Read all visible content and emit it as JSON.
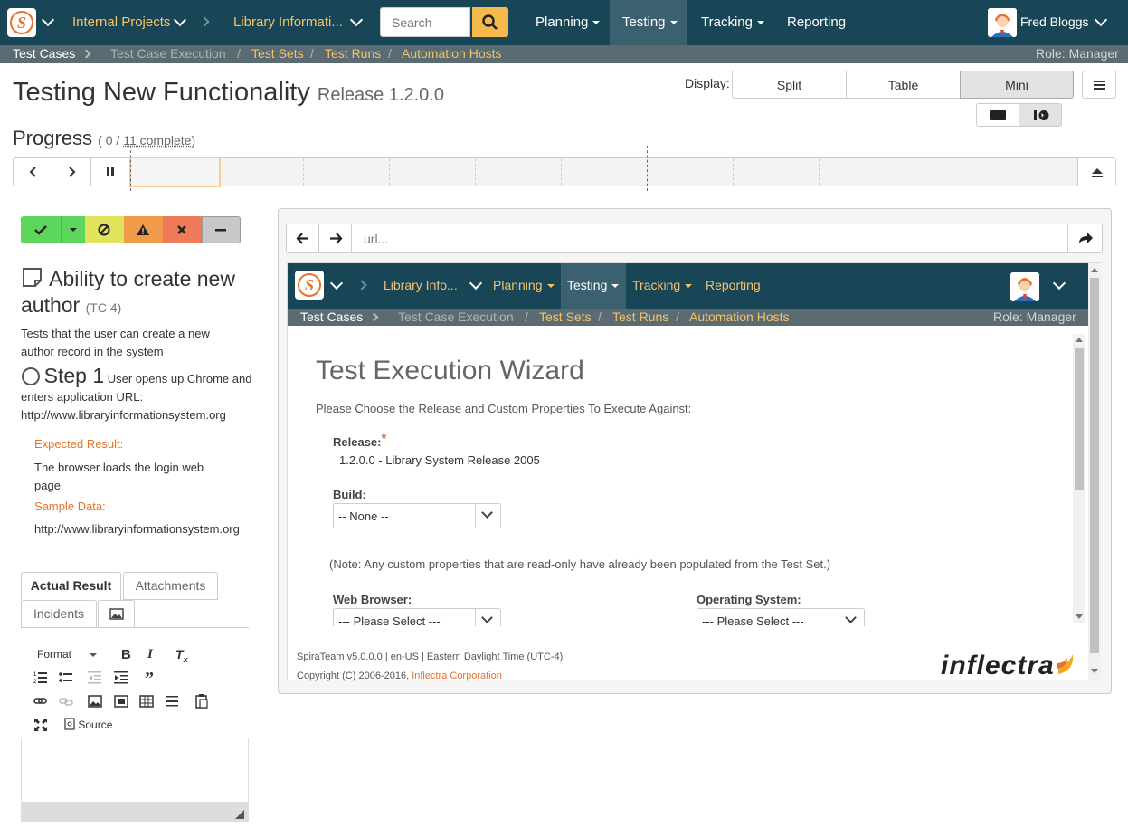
{
  "topnav": {
    "project": "Internal Projects",
    "product": "Library Informati...",
    "search_placeholder": "Search",
    "menu": {
      "planning": "Planning",
      "testing": "Testing",
      "tracking": "Tracking",
      "reporting": "Reporting"
    },
    "user": "Fred Bloggs"
  },
  "subnav": {
    "items": [
      "Test Cases",
      "Test Case Execution",
      "Test Sets",
      "Test Runs",
      "Automation Hosts"
    ],
    "separators": "/",
    "role": "Role: Manager"
  },
  "page": {
    "title": "Testing New Functionality",
    "release": "Release 1.2.0.0",
    "display_label": "Display:",
    "display_options": [
      "Split",
      "Table",
      "Mini"
    ],
    "display_selected": "Mini"
  },
  "progress": {
    "label": "Progress",
    "open_paren": "(",
    "done": "0",
    "slash": "/",
    "total_text": "11 complete",
    "close_paren": ")"
  },
  "testcase": {
    "title": "Ability to create new author",
    "id": "(TC 4)",
    "description": "Tests that the user can create a new author record in the system",
    "step_label": "Step 1",
    "step_desc": "User opens up Chrome and enters application URL: http://www.libraryinformationsystem.org",
    "expected_label": "Expected Result:",
    "expected": "The browser loads the login web page",
    "sample_label": "Sample Data:",
    "sample": "http://www.libraryinformationsystem.org"
  },
  "tabs": [
    "Actual Result",
    "Attachments",
    "Incidents"
  ],
  "editor": {
    "format": "Format",
    "source": "Source"
  },
  "browser": {
    "url_placeholder": "url...",
    "inner_nav": {
      "product": "Library Info...",
      "planning": "Planning",
      "testing": "Testing",
      "tracking": "Tracking",
      "reporting": "Reporting",
      "subitems": [
        "Test Cases",
        "Test Case Execution",
        "Test Sets",
        "Test Runs",
        "Automation Hosts"
      ],
      "role": "Role: Manager"
    },
    "wizard": {
      "title": "Test Execution Wizard",
      "intro": "Please Choose the Release and Custom Properties To Execute Against:",
      "release_label": "Release:",
      "required_mark": "*",
      "release_value": "1.2.0.0 - Library System Release 2005",
      "build_label": "Build:",
      "build_value": "-- None --",
      "note": "(Note: Any custom properties that are read-only have already been populated from the Test Set.)",
      "browser_label": "Web Browser:",
      "browser_value": "--- Please Select ---",
      "os_label": "Operating System:",
      "os_value": "--- Please Select ---"
    },
    "footer": {
      "line1": "SpiraTeam v5.0.0.0 | en-US | Eastern Daylight Time (UTC-4)",
      "line2": "Copyright (C) 2006-2016,",
      "company": "Inflectra Corporation",
      "logo_text": "inflectra"
    }
  },
  "colors": {
    "nav": "#184656",
    "accent": "#f5c26b",
    "orange": "#e8722c",
    "pass": "#5cd65c",
    "blocked": "#e2e35c",
    "caution": "#f09a4a",
    "fail": "#ee7a5a",
    "na": "#c8c8c8"
  }
}
